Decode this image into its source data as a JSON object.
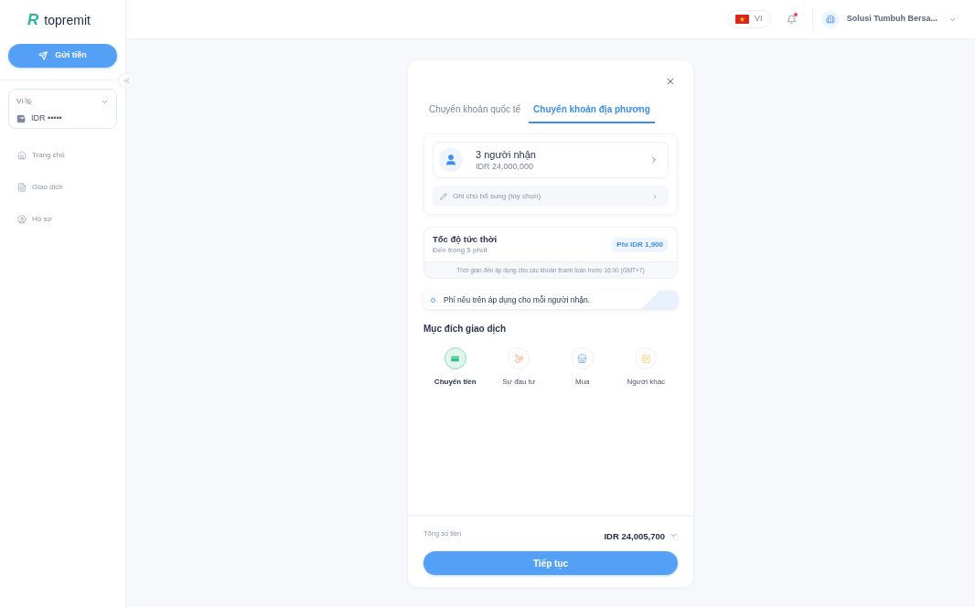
{
  "sidebar": {
    "logo": {
      "mark": "R",
      "name": "topremit"
    },
    "send_button": "Gửi tiền",
    "wallet": {
      "label": "Ví",
      "balance": "IDR •••••"
    },
    "nav_items": [
      {
        "label": "Trang chủ",
        "selected": false
      },
      {
        "label": "Giao dịch",
        "selected": false
      },
      {
        "label": "Hồ sơ",
        "selected": false
      }
    ]
  },
  "header": {
    "language": "VI",
    "notifications": {
      "unread": true
    },
    "account": {
      "name": "Solusi Tumbuh Bersa..."
    }
  },
  "transfer": {
    "tabs": [
      {
        "label": "Chuyển khoản quốc tế",
        "selected": false
      },
      {
        "label": "Chuyển khoản địa phương",
        "selected": true
      }
    ],
    "recipients": {
      "title": "3 người nhận",
      "amount": "IDR 24,000,000"
    },
    "note_button": "Ghi chú bổ sung (tùy chọn)",
    "speed": {
      "title": "Tốc độ tức thời",
      "eta": "Đến trong 5 phút",
      "fee": "Phí IDR 1,900",
      "footnote": "Thời gian đến áp dụng cho các khoản thanh toán trước 16:00 (GMT+7)"
    },
    "info": "Phí nêu trên áp dụng cho mỗi người nhận.",
    "purpose": {
      "title": "Mục đích giao dịch",
      "options": [
        {
          "label": "Chuyển tiền",
          "selected": true
        },
        {
          "label": "Sự đầu tư",
          "selected": false
        },
        {
          "label": "Mua",
          "selected": false
        },
        {
          "label": "Người khác",
          "selected": false
        }
      ]
    },
    "total": {
      "label": "Tổng số tiền",
      "amount": "IDR 24,005,700"
    },
    "continue_button": "Tiếp tục"
  }
}
